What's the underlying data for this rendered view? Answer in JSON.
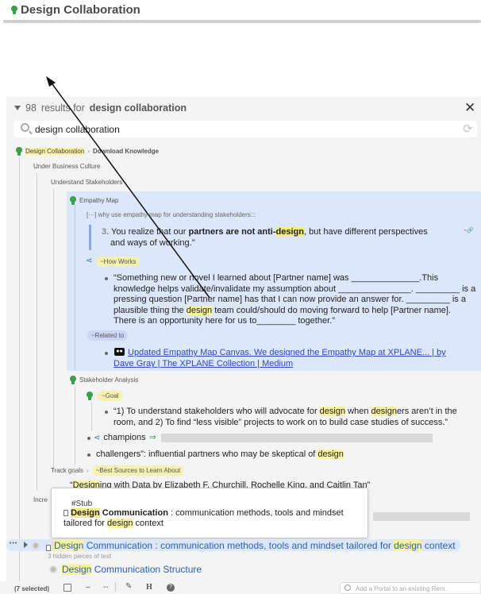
{
  "header": {
    "title": "Design Collaboration"
  },
  "search": {
    "count": "98",
    "count_label": "results for",
    "query_bold": "design collaboration",
    "query": "design collaboration"
  },
  "breadcrumb": {
    "root": "Design Collaboration",
    "sep": "›",
    "child": "Download Knowledge"
  },
  "tree": {
    "under_business_culture": "Under Business Culture",
    "understand_stakeholders": "Understand Stakeholders",
    "empathy_map": "Empathy Map",
    "empathy_subtitle": "[···] why use empathy map for understanding stakeholders:::",
    "quote_num": "3.",
    "quote_a": "You realize that our ",
    "quote_b": "partners are not anti-",
    "quote_c": "design",
    "quote_d": ", but have different perspectives",
    "quote_line2": "and ways of working.”",
    "how_works": "~How Works",
    "hw_line1": "“Something new or novel I learned about [Partner name] was ______________.This",
    "hw_line2": "knowledge helps validate/invalidate my assumption about _______________. _________ is a",
    "hw_line3": "pressing question [Partner name] has that I can now provide an answer for. _________ is a",
    "hw_line4a": "plausible thing the ",
    "hw_line4b": "design",
    "hw_line4c": " team could/should do moving forward to help [Partner name].",
    "hw_line5": "There is an opportunity here for us to________ together.”",
    "related_to": "~Related to",
    "link_line1": "Updated Empathy Map Canvas. We designed the Empathy Map at XPLANE... | by",
    "link_line2": "Dave Gray | The XPLANE Collection | Medium",
    "stakeholder_analysis": "Stakeholder Analysis",
    "goal": "~Goal",
    "goal_line1a": "“1) To understand stakeholders who will advocate for ",
    "goal_line1b": "design",
    "goal_line1c": " when ",
    "goal_line1d": "design",
    "goal_line1e": "ers aren’t in the",
    "goal_line2": "room, and 2) To find “less visible” projects to work on to build case studies of success.”",
    "champions": "champions",
    "champions_arrow": "⇒",
    "challengers_a": "challengers”: influential partners who may be skeptical of ",
    "challengers_b": "design",
    "track_goals": "Track goals",
    "track_sep": "›",
    "best_sources": "~Best Sources to Learn About",
    "designing_a": "“",
    "designing_b": "Design",
    "designing_c": "ing with Data by Elizabeth F. Churchill, Rochelle King, and Caitlin Tan”",
    "incre": "Incre"
  },
  "tooltip": {
    "stub": "#Stub",
    "title_a": "Design",
    "title_b": " Communication",
    "desc1": " : communication methods, tools and mindset",
    "desc2a": "tailored for ",
    "desc2b": "design",
    "desc2c": " context"
  },
  "result_row": {
    "dots": "•••",
    "title_a": "Design",
    "title_b": " Communication",
    "desc_a": " : communication methods, tools and mindset tailored for ",
    "desc_b": "design",
    "desc_c": " context",
    "hidden": "3 hidden pieces of text"
  },
  "structure_row": {
    "title_a": "Design",
    "title_b": " Communication Structure"
  },
  "footer": {
    "selected": "(7 selected)",
    "dash1": "–",
    "dash2": "--",
    "h": "H",
    "help": "?",
    "portal_placeholder": "Add a Portal to an existing Rem."
  },
  "colors": {
    "highlight": "#f7f3a0",
    "selection_blue": "#dde7fb",
    "bulb_green": "#3aa14a",
    "link_blue": "#2b48c4"
  }
}
